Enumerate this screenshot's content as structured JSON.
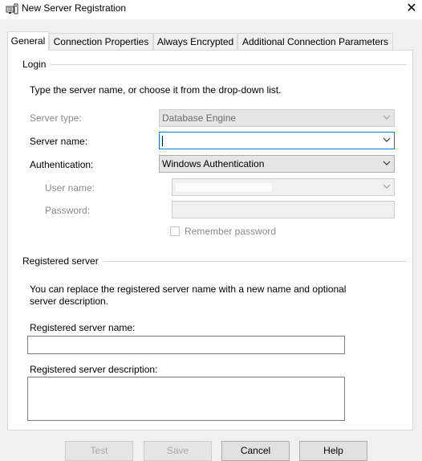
{
  "window": {
    "title": "New Server Registration",
    "close_glyph": "✕"
  },
  "tabs": [
    {
      "label": "General",
      "active": true
    },
    {
      "label": "Connection Properties"
    },
    {
      "label": "Always Encrypted"
    },
    {
      "label": "Additional Connection Parameters"
    }
  ],
  "login": {
    "group_title": "Login",
    "instructions": "Type the server name, or choose it from the drop-down list.",
    "server_type_label": "Server type:",
    "server_type_value": "Database Engine",
    "server_name_label": "Server name:",
    "server_name_value": "",
    "authentication_label": "Authentication:",
    "authentication_value": "Windows Authentication",
    "user_name_label": "User name:",
    "user_name_value": "",
    "password_label": "Password:",
    "password_value": "",
    "remember_password_label": "Remember password",
    "remember_password_checked": false
  },
  "registered": {
    "group_title": "Registered server",
    "description_line1": "You can replace the registered server name with a new name and optional",
    "description_line2": "server description.",
    "name_label": "Registered server name:",
    "name_value": "",
    "description_label": "Registered server description:",
    "description_value": ""
  },
  "buttons": {
    "test": "Test",
    "save": "Save",
    "cancel": "Cancel",
    "help": "Help"
  },
  "icons": {
    "window": "server-registration-icon",
    "dropdown": "chevron-down-icon"
  },
  "colors": {
    "disabled_text": "#8a8a8a",
    "focus_border": "#0078d7",
    "border": "#adadad",
    "panel_bg": "#ffffff",
    "dialog_bg": "#f0f0f0"
  }
}
